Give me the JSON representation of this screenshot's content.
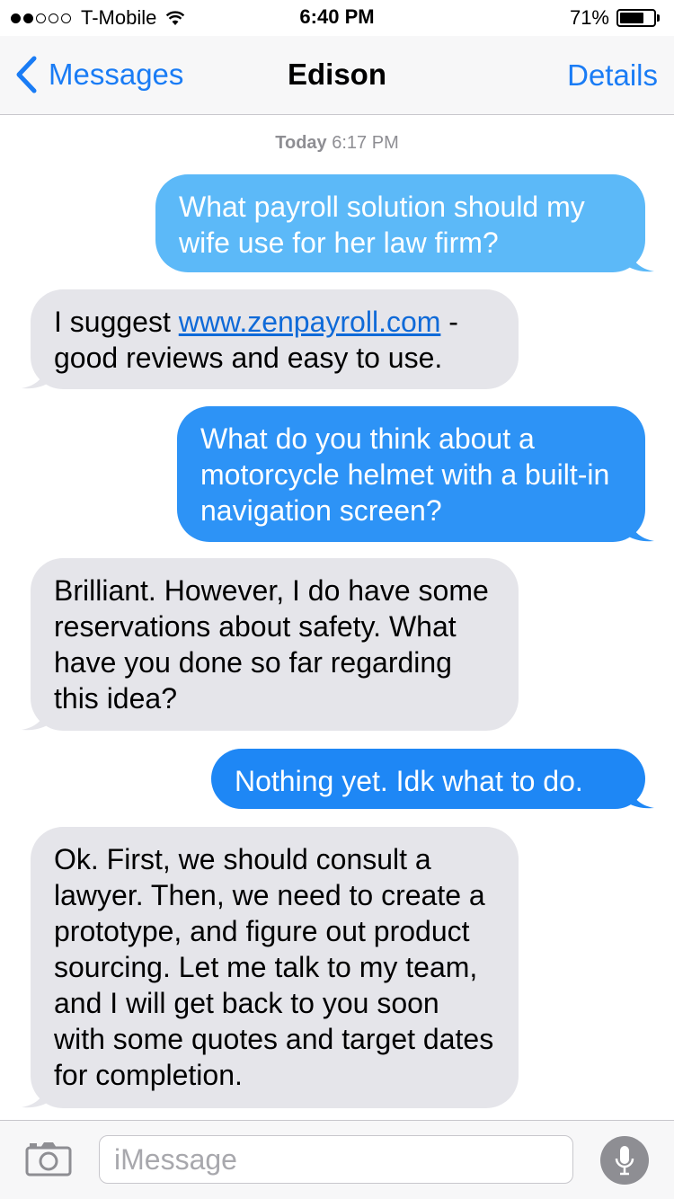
{
  "status_bar": {
    "carrier": "T-Mobile",
    "signal": {
      "filled": 2,
      "total": 5
    },
    "time": "6:40 PM",
    "battery_percent": "71%",
    "battery_level": 0.71
  },
  "nav": {
    "back_label": "Messages",
    "title": "Edison",
    "details_label": "Details"
  },
  "timestamp": {
    "day": "Today",
    "time": "6:17 PM"
  },
  "messages": [
    {
      "direction": "outgoing",
      "text": "What payroll solution should my wife use for her law firm?"
    },
    {
      "direction": "incoming",
      "text_before": "I suggest ",
      "link": "www.zenpayroll.com",
      "text_after": " - good reviews and easy to use."
    },
    {
      "direction": "outgoing",
      "text": "What do you think about a motorcycle helmet with a built-in navigation screen?"
    },
    {
      "direction": "incoming",
      "text": "Brilliant. However, I do have some reservations about safety. What have you done so far regarding this idea?"
    },
    {
      "direction": "outgoing",
      "text": "Nothing yet. Idk what to do."
    },
    {
      "direction": "incoming",
      "text": "Ok. First, we should consult a lawyer. Then, we need to create a prototype, and figure out product sourcing. Let me talk to my team, and I will get back to you soon with some quotes and target dates for completion."
    }
  ],
  "input_bar": {
    "placeholder": "iMessage",
    "value": ""
  },
  "icons": {
    "back": "chevron-left-icon",
    "camera": "camera-icon",
    "microphone": "microphone-icon",
    "wifi": "wifi-icon",
    "battery": "battery-icon"
  },
  "colors": {
    "accent": "#1a7cf5",
    "incoming_bubble": "#e5e5ea",
    "outgoing_bubble_top": "#5cb9f8",
    "outgoing_bubble_mid": "#2d93f6",
    "outgoing_bubble_bottom": "#1e87f5",
    "link": "#0f6ad8",
    "mic_button": "#8e8e93"
  }
}
